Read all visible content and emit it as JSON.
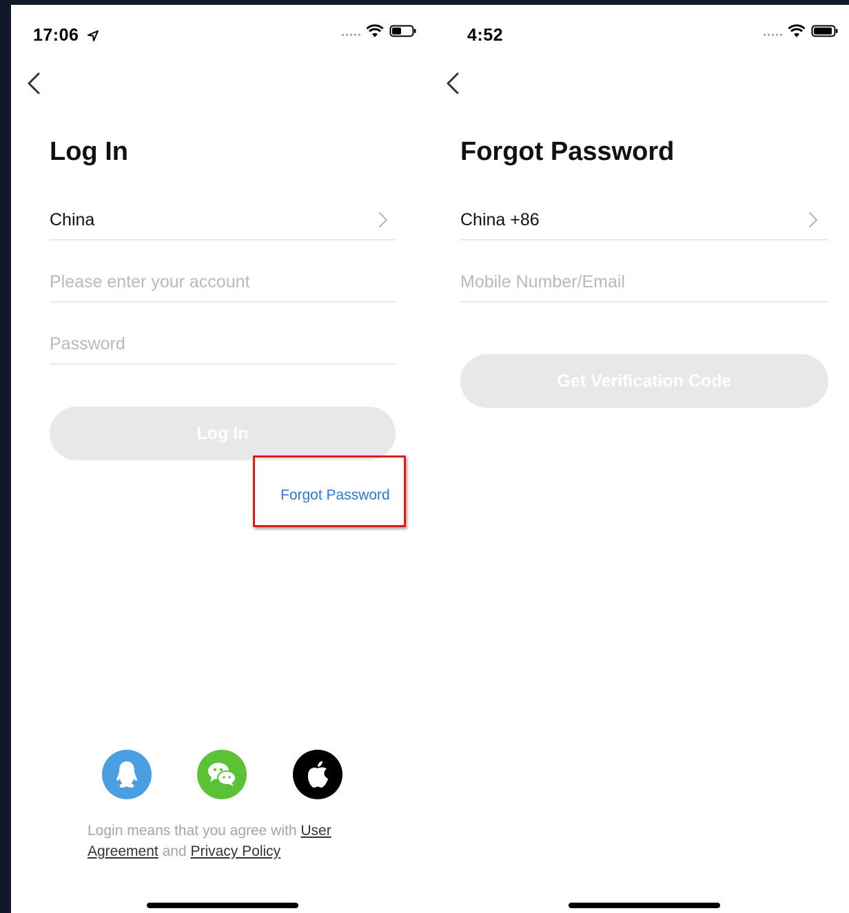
{
  "login_screen": {
    "status": {
      "time": "17:06"
    },
    "title": "Log In",
    "region": "China",
    "account_placeholder": "Please enter your account",
    "password_placeholder": "Password",
    "login_button": "Log In",
    "forgot_password": "Forgot Password",
    "social_icons": [
      "qq-icon",
      "wechat-icon",
      "apple-icon"
    ],
    "agreement": {
      "prefix": "Login means that you agree with ",
      "user_agreement": "User Agreement",
      "joiner": " and ",
      "privacy_policy": "Privacy Policy"
    }
  },
  "forgot_screen": {
    "status": {
      "time": "4:52"
    },
    "title": "Forgot Password",
    "region": "China +86",
    "contact_placeholder": "Mobile Number/Email",
    "verify_button": "Get Verification Code"
  },
  "colors": {
    "link_blue": "#2f77d0",
    "highlight_red": "#e01b1b",
    "disabled_button": "#e8e8e8",
    "qq_blue": "#4a9fe0",
    "wechat_green": "#5bc236",
    "apple_black": "#000000"
  }
}
